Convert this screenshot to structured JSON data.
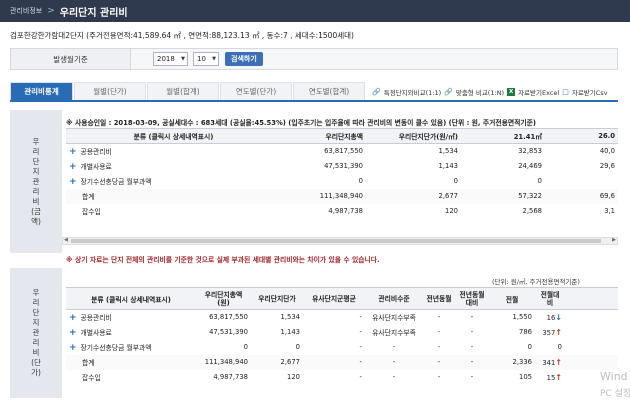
{
  "breadcrumb": {
    "root": "관리비정보",
    "separator": ">",
    "current": "우리단지 관리비"
  },
  "complex_info": "검포한강한가람대2단지 (주거전용면적:41,589.64 ㎡ , 연면적:88,123.13 ㎡ , 동수:7 , 세대수:1500세대)",
  "filter": {
    "label": "발생월기준",
    "year": "2018",
    "month": "10",
    "search_label": "검색하기"
  },
  "tabs": [
    "관리비통계",
    "월별(단가)",
    "월별(합계)",
    "연도별(단가)",
    "연도별(합계)"
  ],
  "tab_links": {
    "compare": "특정단지와비교(1:1)",
    "custom_compare": "맞춤형 비교(1:N)",
    "excel": "자료받기Excel",
    "csv": "자료받기Csv"
  },
  "section1": {
    "label": [
      "우",
      "리",
      "단",
      "지",
      "관",
      "리",
      "비",
      "(금",
      "액)"
    ],
    "notice": "※ 사용승인일 : 2018-03-09, 공실세대수 : 683세대 (공실율:45.53%) (입주초기는 입주율에 따라 관리비의 변동이 클수 있음) (단위 : 원, 주거전용면적기준)",
    "headers": [
      "분류 (클릭시 상세내역표시)",
      "우리단지총액",
      "우리단지단가(원/㎡)",
      "21.41㎡",
      "26.0"
    ],
    "rows": [
      {
        "label": "공용관리비",
        "plus": true,
        "total": "63,817,550",
        "unit": "1,534",
        "c1": "32,853",
        "c2": "40,0"
      },
      {
        "label": "개별사용료",
        "plus": true,
        "total": "47,531,390",
        "unit": "1,143",
        "c1": "24,469",
        "c2": "29,6"
      },
      {
        "label": "장기수선충당금 월부과액",
        "plus": true,
        "total": "0",
        "unit": "0",
        "c1": "0",
        "c2": ""
      },
      {
        "label": "합계",
        "plus": false,
        "total": "111,348,940",
        "unit": "2,677",
        "c1": "57,322",
        "c2": "69,6"
      },
      {
        "label": "잡수입",
        "plus": false,
        "total": "4,987,738",
        "unit": "120",
        "c1": "2,568",
        "c2": "3,1"
      }
    ]
  },
  "notice2": "※ 상기 자료는 단지 전체의 관리비를 기준한 것으로 실제 부과된 세대별 관리비와는 차이가 있을 수 있습니다.",
  "section2": {
    "label": [
      "우",
      "리",
      "단",
      "지",
      "관",
      "리",
      "비",
      "(단",
      "가)"
    ],
    "unit": "(단위: 원/㎡, 주거전용면적기준)",
    "headers": [
      "분류 (클릭시 상세내역표시)",
      "우리단지총액(원)",
      "우리단지단가",
      "유사단지군평균",
      "관리비수준",
      "전년동월",
      "전년동월대비",
      "전월",
      "전월대비"
    ],
    "rows": [
      {
        "label": "공용관리비",
        "plus": true,
        "total": "63,817,550",
        "unit": "1,534",
        "avg": "-",
        "level": "유사단지수부족",
        "py": "-",
        "pyd": "-",
        "pm": "1,550",
        "pmd": "16",
        "dir": "down"
      },
      {
        "label": "개별사용료",
        "plus": true,
        "total": "47,531,390",
        "unit": "1,143",
        "avg": "-",
        "level": "유사단지수부족",
        "py": "-",
        "pyd": "-",
        "pm": "786",
        "pmd": "357",
        "dir": "up"
      },
      {
        "label": "장기수선충당금 월부과액",
        "plus": true,
        "total": "0",
        "unit": "0",
        "avg": "-",
        "level": "-",
        "py": "-",
        "pyd": "-",
        "pm": "0",
        "pmd": "0",
        "dir": ""
      },
      {
        "label": "합계",
        "plus": false,
        "total": "111,348,940",
        "unit": "2,677",
        "avg": "-",
        "level": "-",
        "py": "-",
        "pyd": "-",
        "pm": "2,336",
        "pmd": "341",
        "dir": "up"
      },
      {
        "label": "잡수입",
        "plus": false,
        "total": "4,987,738",
        "unit": "120",
        "avg": "-",
        "level": "-",
        "py": "-",
        "pyd": "-",
        "pm": "105",
        "pmd": "15",
        "dir": "up"
      }
    ]
  },
  "watermark": {
    "line1": "Wind",
    "line2": "PC 설정"
  },
  "colors": {
    "topbar": "#2f3a4e",
    "accent": "#2a6bb5",
    "notice_red": "#a3262a",
    "up": "#c0392b"
  }
}
